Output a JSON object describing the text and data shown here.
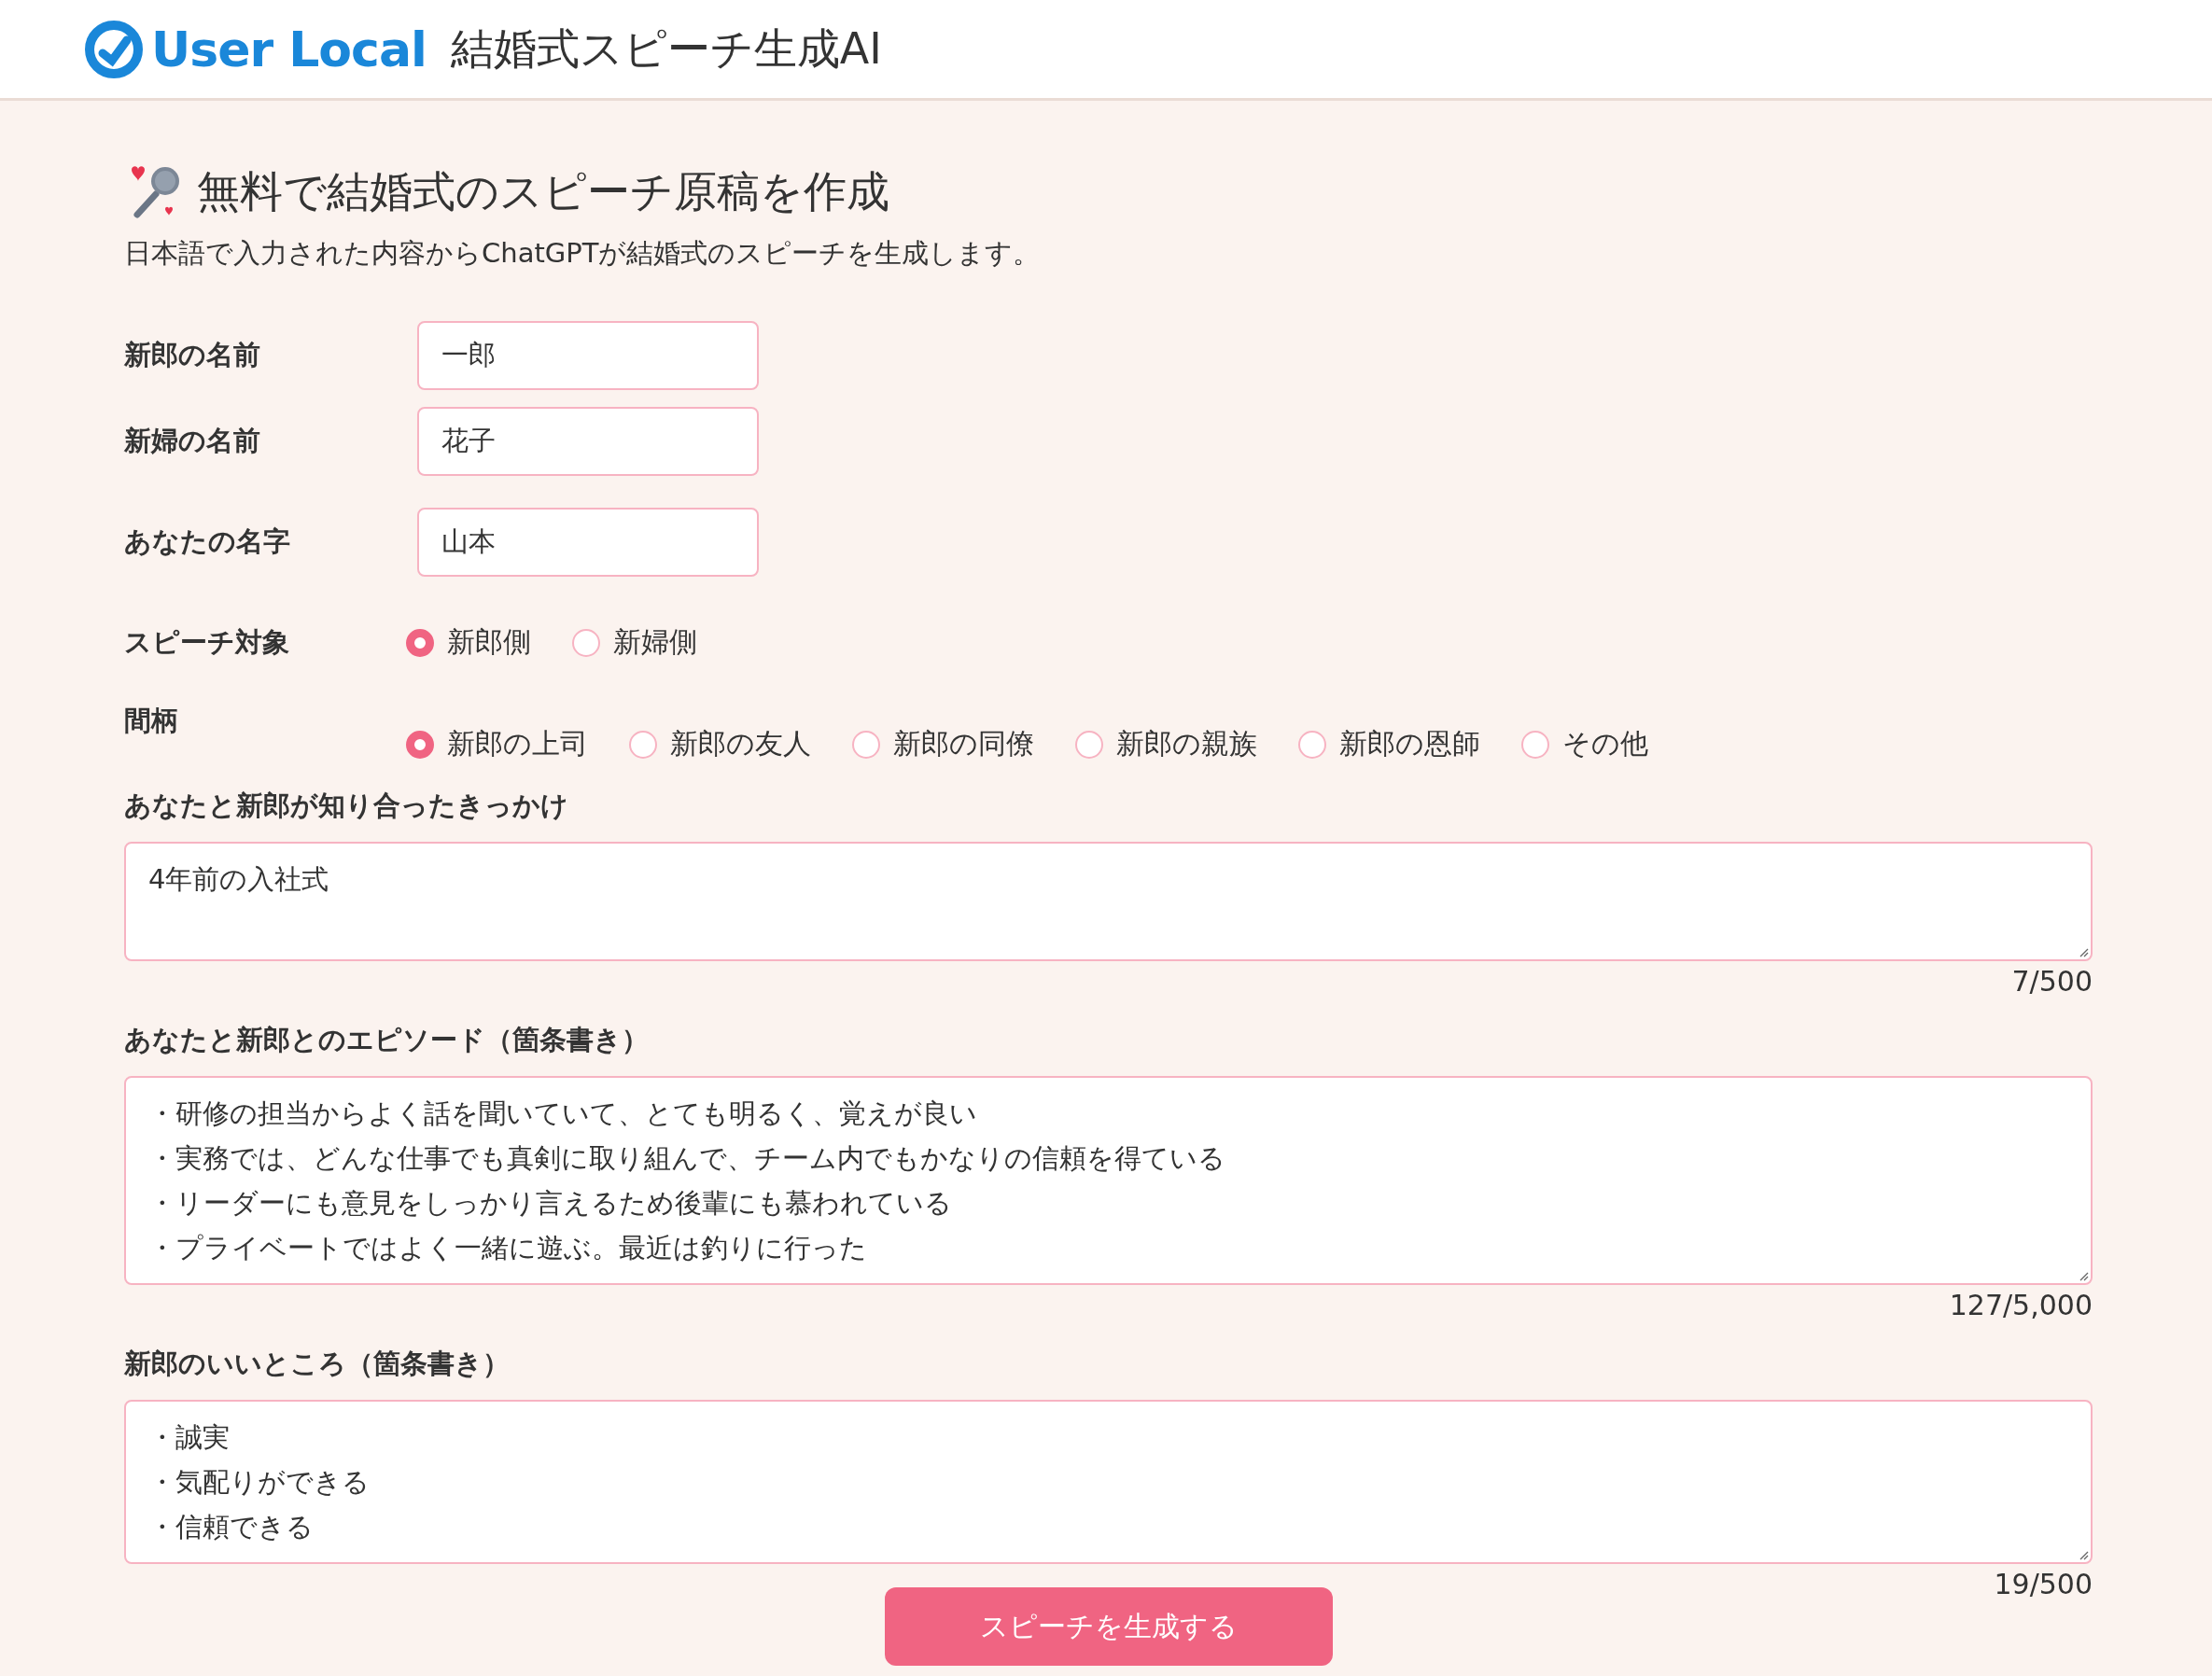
{
  "header": {
    "brand": "User Local",
    "title": "結婚式スピーチ生成AI"
  },
  "heading": "無料で結婚式のスピーチ原稿を作成",
  "description": "日本語で入力された内容からChatGPTが結婚式のスピーチを生成します。",
  "fields": [
    {
      "label": "新郎の名前",
      "value": "一郎"
    },
    {
      "label": "新婦の名前",
      "value": "花子"
    },
    {
      "label": "あなたの名字",
      "value": "山本"
    }
  ],
  "radio_groups": [
    {
      "label": "スピーチ対象",
      "options": [
        {
          "label": "新郎側",
          "selected": true
        },
        {
          "label": "新婦側",
          "selected": false
        }
      ]
    },
    {
      "label": "間柄",
      "options": [
        {
          "label": "新郎の上司",
          "selected": true
        },
        {
          "label": "新郎の友人",
          "selected": false
        },
        {
          "label": "新郎の同僚",
          "selected": false
        },
        {
          "label": "新郎の親族",
          "selected": false
        },
        {
          "label": "新郎の恩師",
          "selected": false
        },
        {
          "label": "その他",
          "selected": false
        }
      ]
    }
  ],
  "text_areas": [
    {
      "label": "あなたと新郎が知り合ったきっかけ",
      "lines": [
        "4年前の入社式"
      ],
      "count": "7/500"
    },
    {
      "label": "あなたと新郎とのエピソード（箇条書き）",
      "lines": [
        "・研修の担当からよく話を聞いていて、とても明るく、覚えが良い",
        "・実務では、どんな仕事でも真剣に取り組んで、チーム内でもかなりの信頼を得ている",
        "・リーダーにも意見をしっかり言えるため後輩にも慕われている",
        "・プライベートではよく一緒に遊ぶ。最近は釣りに行った"
      ],
      "count": "127/5,000"
    },
    {
      "label": "新郎のいいところ（箇条書き）",
      "lines": [
        "・誠実",
        "・気配りができる",
        "・信頼できる"
      ],
      "count": "19/500"
    }
  ],
  "submit": "スピーチを生成する"
}
